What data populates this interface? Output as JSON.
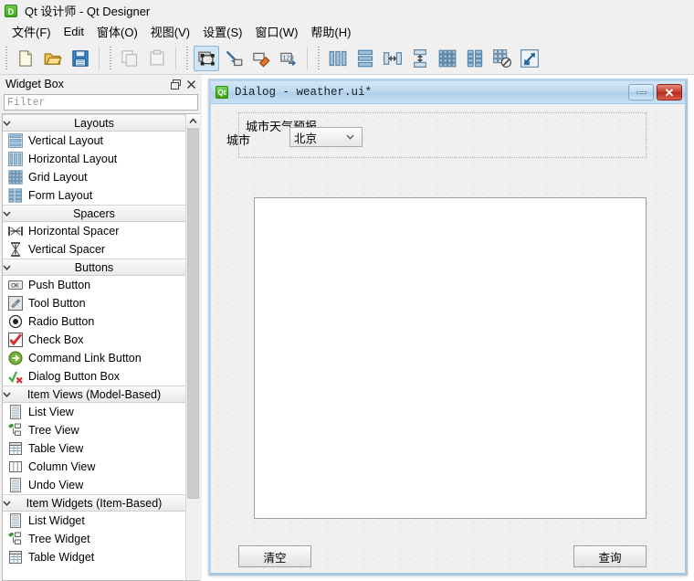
{
  "window": {
    "title": "Qt 设计师 - Qt Designer",
    "app_icon": "D"
  },
  "menubar": {
    "items": [
      {
        "label": "文件(F)",
        "name": "menu-file"
      },
      {
        "label": "Edit",
        "name": "menu-edit"
      },
      {
        "label": "窗体(O)",
        "name": "menu-form"
      },
      {
        "label": "视图(V)",
        "name": "menu-view"
      },
      {
        "label": "设置(S)",
        "name": "menu-settings"
      },
      {
        "label": "窗口(W)",
        "name": "menu-window"
      },
      {
        "label": "帮助(H)",
        "name": "menu-help"
      }
    ]
  },
  "toolbar": {
    "groups": [
      {
        "buttons": [
          {
            "icon": "new-file-icon",
            "enabled": true,
            "active": false
          },
          {
            "icon": "open-folder-icon",
            "enabled": true,
            "active": false
          },
          {
            "icon": "save-disk-icon",
            "enabled": true,
            "active": false
          }
        ]
      },
      {
        "buttons": [
          {
            "icon": "copy-icon",
            "enabled": false,
            "active": false
          },
          {
            "icon": "paste-icon",
            "enabled": false,
            "active": false
          }
        ]
      },
      {
        "buttons": [
          {
            "icon": "edit-widgets-icon",
            "enabled": true,
            "active": true
          },
          {
            "icon": "edit-signals-slots-icon",
            "enabled": true,
            "active": false
          },
          {
            "icon": "edit-buddies-icon",
            "enabled": true,
            "active": false
          },
          {
            "icon": "edit-tab-order-icon",
            "enabled": true,
            "active": false
          }
        ]
      },
      {
        "buttons": [
          {
            "icon": "layout-horizontal-icon",
            "enabled": true,
            "active": false
          },
          {
            "icon": "layout-vertical-icon",
            "enabled": true,
            "active": false
          },
          {
            "icon": "layout-splitter-h-icon",
            "enabled": true,
            "active": false
          },
          {
            "icon": "layout-splitter-v-icon",
            "enabled": true,
            "active": false
          },
          {
            "icon": "layout-grid-icon",
            "enabled": true,
            "active": false
          },
          {
            "icon": "layout-form-icon",
            "enabled": true,
            "active": false
          },
          {
            "icon": "break-layout-icon",
            "enabled": true,
            "active": false
          },
          {
            "icon": "adjust-size-icon",
            "enabled": true,
            "active": false
          }
        ]
      }
    ]
  },
  "widget_box": {
    "title": "Widget Box",
    "float_button": "undock-icon",
    "close_button": "close-icon",
    "filter": {
      "placeholder": "Filter",
      "value": ""
    },
    "scroll_up_arrow": "chevron-up-icon",
    "categories": [
      {
        "label": "Layouts",
        "expanded": true,
        "items": [
          {
            "label": "Vertical Layout",
            "icon": "vertical-layout-icon"
          },
          {
            "label": "Horizontal Layout",
            "icon": "horizontal-layout-icon"
          },
          {
            "label": "Grid Layout",
            "icon": "grid-layout-icon"
          },
          {
            "label": "Form Layout",
            "icon": "form-layout-icon"
          }
        ]
      },
      {
        "label": "Spacers",
        "expanded": true,
        "items": [
          {
            "label": "Horizontal Spacer",
            "icon": "horizontal-spacer-icon"
          },
          {
            "label": "Vertical Spacer",
            "icon": "vertical-spacer-icon"
          }
        ]
      },
      {
        "label": "Buttons",
        "expanded": true,
        "items": [
          {
            "label": "Push Button",
            "icon": "push-button-icon"
          },
          {
            "label": "Tool Button",
            "icon": "tool-button-icon"
          },
          {
            "label": "Radio Button",
            "icon": "radio-button-icon"
          },
          {
            "label": "Check Box",
            "icon": "check-box-icon"
          },
          {
            "label": "Command Link Button",
            "icon": "command-link-icon"
          },
          {
            "label": "Dialog Button Box",
            "icon": "dialog-button-box-icon"
          }
        ]
      },
      {
        "label": "Item Views (Model-Based)",
        "expanded": true,
        "items": [
          {
            "label": "List View",
            "icon": "list-view-icon"
          },
          {
            "label": "Tree View",
            "icon": "tree-view-icon"
          },
          {
            "label": "Table View",
            "icon": "table-view-icon"
          },
          {
            "label": "Column View",
            "icon": "column-view-icon"
          },
          {
            "label": "Undo View",
            "icon": "undo-view-icon"
          }
        ]
      },
      {
        "label": "Item Widgets (Item-Based)",
        "expanded": true,
        "items": [
          {
            "label": "List Widget",
            "icon": "list-widget-icon"
          },
          {
            "label": "Tree Widget",
            "icon": "tree-widget-icon"
          },
          {
            "label": "Table Widget",
            "icon": "table-widget-icon"
          }
        ]
      }
    ]
  },
  "dialog": {
    "icon": "Qt",
    "title": "Dialog - weather.ui*",
    "minimize_label": "minimize-icon",
    "close_label": "✕",
    "form": {
      "heading": "城市天气预报",
      "city_label": "城市",
      "city_combo": {
        "value": "北京",
        "arrow": "chevron-down-icon",
        "options": [
          "北京"
        ]
      }
    },
    "text_edit": {
      "value": ""
    },
    "buttons": {
      "clear": "清空",
      "query": "查询"
    }
  },
  "colors": {
    "accent": "#cfe6f7",
    "title_gradient_top": "#d4e6f5",
    "title_gradient_bottom": "#c8e0f2",
    "close_red": "#c6392a",
    "qt_green": "#35a010",
    "panel_bg": "#f0f0f0"
  }
}
